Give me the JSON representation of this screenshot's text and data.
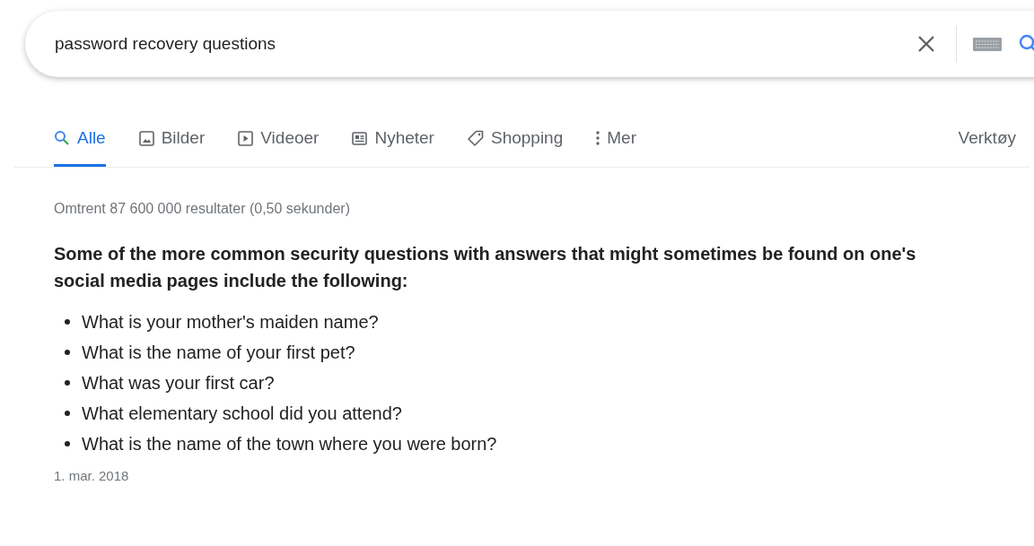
{
  "search": {
    "value": "password recovery questions"
  },
  "tabs": [
    {
      "label": "Alle",
      "kind": "search",
      "selected": true
    },
    {
      "label": "Bilder",
      "kind": "image",
      "selected": false
    },
    {
      "label": "Videoer",
      "kind": "video",
      "selected": false
    },
    {
      "label": "Nyheter",
      "kind": "news",
      "selected": false
    },
    {
      "label": "Shopping",
      "kind": "tag",
      "selected": false
    },
    {
      "label": "Mer",
      "kind": "more",
      "selected": false
    }
  ],
  "tools": "Verktøy",
  "result_stats": "Omtrent 87 600 000 resultater (0,50 sekunder)",
  "snippet": {
    "heading": "Some of the more common security questions with answers that might sometimes be found on one's social media pages include the following:",
    "items": [
      "What is your mother's maiden name?",
      "What is the name of your first pet?",
      "What was your first car?",
      "What elementary school did you attend?",
      "What is the name of the town where you were born?"
    ],
    "date": "1. mar. 2018"
  }
}
